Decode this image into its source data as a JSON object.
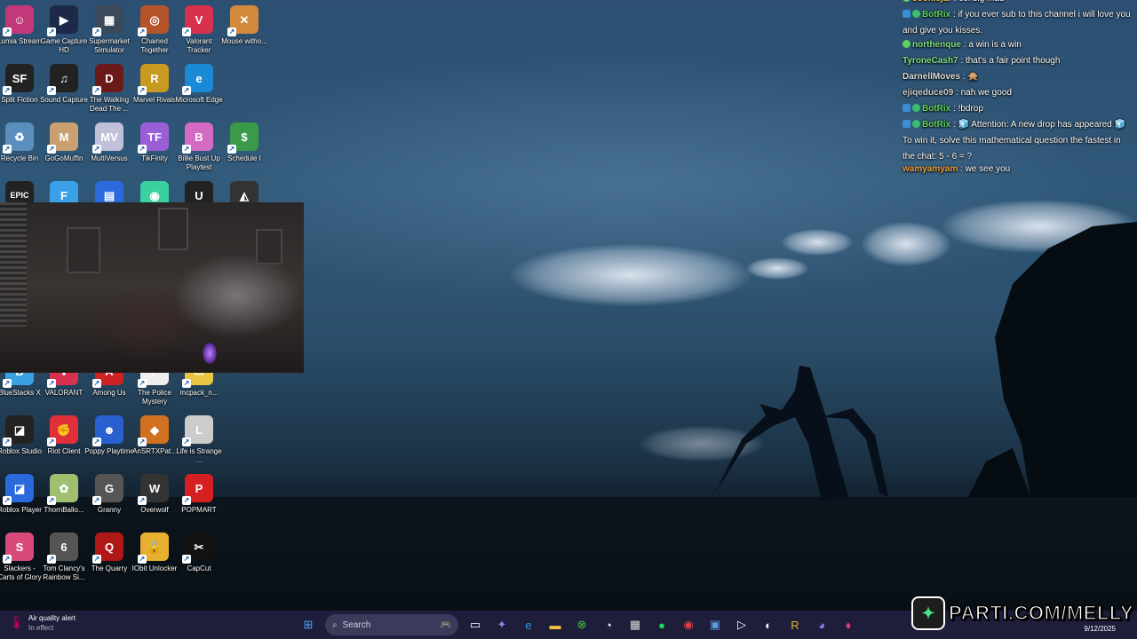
{
  "desktop_icons": [
    {
      "label": "Lumia Stream",
      "glyph": "☺",
      "color": "#c2397a",
      "col": 0,
      "row": 0
    },
    {
      "label": "Game Capture HD",
      "glyph": "▶",
      "color": "#1c2a48",
      "col": 1,
      "row": 0
    },
    {
      "label": "Supermarket Simulator",
      "glyph": "▦",
      "color": "#3b4a5a",
      "col": 2,
      "row": 0
    },
    {
      "label": "Chained Together",
      "glyph": "◎",
      "color": "#b5532a",
      "col": 3,
      "row": 0
    },
    {
      "label": "Valorant Tracker",
      "glyph": "V",
      "color": "#d8314d",
      "col": 4,
      "row": 0
    },
    {
      "label": "Mouse witho...",
      "glyph": "✕",
      "color": "#d28a3c",
      "col": 5,
      "row": 0
    },
    {
      "label": "Split Fiction",
      "glyph": "SF",
      "color": "#222",
      "col": 0,
      "row": 1
    },
    {
      "label": "Sound Capture",
      "glyph": "♫",
      "color": "#222",
      "col": 1,
      "row": 1
    },
    {
      "label": "The Walking Dead The ...",
      "glyph": "D",
      "color": "#6b1a1a",
      "col": 2,
      "row": 1
    },
    {
      "label": "Marvel Rivals",
      "glyph": "R",
      "color": "#c99a22",
      "col": 3,
      "row": 1
    },
    {
      "label": "Microsoft Edge",
      "glyph": "e",
      "color": "#1b8ad6",
      "col": 4,
      "row": 1
    },
    {
      "label": "Recycle Bin",
      "glyph": "♻",
      "color": "#5a8fbd",
      "col": 0,
      "row": 2
    },
    {
      "label": "GoGoMuffin",
      "glyph": "M",
      "color": "#caa070",
      "col": 1,
      "row": 2
    },
    {
      "label": "MultiVersus",
      "glyph": "MV",
      "color": "#c0c0d8",
      "col": 2,
      "row": 2
    },
    {
      "label": "TikFinity",
      "glyph": "TF",
      "color": "#9a5fd6",
      "col": 3,
      "row": 2
    },
    {
      "label": "Billie Bust Up Playtest",
      "glyph": "B",
      "color": "#d46ac4",
      "col": 4,
      "row": 2
    },
    {
      "label": "Schedule I",
      "glyph": "$",
      "color": "#3a9a4a",
      "col": 5,
      "row": 2
    },
    {
      "label": "BlueStacks X",
      "glyph": "B",
      "color": "#3aa0e0",
      "col": 0,
      "row": 6
    },
    {
      "label": "VALORANT",
      "glyph": "V",
      "color": "#d8314d",
      "col": 1,
      "row": 6
    },
    {
      "label": "Among Us",
      "glyph": "A",
      "color": "#c22",
      "col": 2,
      "row": 6
    },
    {
      "label": "The Police Mystery",
      "glyph": "P",
      "color": "#eee",
      "col": 3,
      "row": 6
    },
    {
      "label": "mcpack_n...",
      "glyph": "▭",
      "color": "#e8c440",
      "col": 4,
      "row": 6
    },
    {
      "label": "Roblox Studio",
      "glyph": "◪",
      "color": "#222",
      "col": 0,
      "row": 7
    },
    {
      "label": "Riot Client",
      "glyph": "✊",
      "color": "#e0303a",
      "col": 1,
      "row": 7
    },
    {
      "label": "Poppy Playtime",
      "glyph": "☻",
      "color": "#2a5fd0",
      "col": 2,
      "row": 7
    },
    {
      "label": "AnSRTXPat...",
      "glyph": "◆",
      "color": "#d07020",
      "col": 3,
      "row": 7
    },
    {
      "label": "Life is Strange ...",
      "glyph": "L",
      "color": "#ccc",
      "col": 4,
      "row": 7
    },
    {
      "label": "Roblox Player",
      "glyph": "◪",
      "color": "#2a6adc",
      "col": 0,
      "row": 8
    },
    {
      "label": "ThornBallo...",
      "glyph": "✿",
      "color": "#a0c070",
      "col": 1,
      "row": 8
    },
    {
      "label": "Granny",
      "glyph": "G",
      "color": "#555",
      "col": 2,
      "row": 8
    },
    {
      "label": "Overwolf",
      "glyph": "W",
      "color": "#333",
      "col": 3,
      "row": 8
    },
    {
      "label": "POPMART",
      "glyph": "P",
      "color": "#d42020",
      "col": 4,
      "row": 8
    },
    {
      "label": "Slackers - Carts of Glory",
      "glyph": "S",
      "color": "#d84a7a",
      "col": 0,
      "row": 9
    },
    {
      "label": "Tom Clancy's Rainbow Si...",
      "glyph": "6",
      "color": "#555",
      "col": 1,
      "row": 9
    },
    {
      "label": "The Quarry",
      "glyph": "Q",
      "color": "#b01818",
      "col": 2,
      "row": 9
    },
    {
      "label": "IObit Unlocker",
      "glyph": "🔓",
      "color": "#e8b030",
      "col": 3,
      "row": 9
    },
    {
      "label": "CapCut",
      "glyph": "✂",
      "color": "#111",
      "col": 4,
      "row": 9
    },
    {
      "label": "",
      "glyph": "EPIC",
      "color": "#222",
      "col": 0,
      "row": 3
    },
    {
      "label": "",
      "glyph": "F",
      "color": "#3aa0e8",
      "col": 1,
      "row": 3
    },
    {
      "label": "",
      "glyph": "▤",
      "color": "#2a6adc",
      "col": 2,
      "row": 3
    },
    {
      "label": "",
      "glyph": "◉",
      "color": "#3ad0a0",
      "col": 3,
      "row": 3
    },
    {
      "label": "",
      "glyph": "U",
      "color": "#222",
      "col": 4,
      "row": 3
    },
    {
      "label": "",
      "glyph": "◭",
      "color": "#333",
      "col": 5,
      "row": 3
    }
  ],
  "chat": [
    {
      "name": "cookiejar",
      "name_color": "#f5c542",
      "text": "col big mad",
      "badges": [
        "gem"
      ]
    },
    {
      "name": "BotRix",
      "name_color": "#5fd35f",
      "text": "if you ever sub to this channel i will love you and give you kisses.",
      "badges": [
        "bot",
        "check"
      ]
    },
    {
      "name": "northenque",
      "name_color": "#7ee07e",
      "text": "a win is a win",
      "badges": [
        "gem"
      ]
    },
    {
      "name": "TyroneCash7",
      "name_color": "#7ee07e",
      "text": "that's a fair point though",
      "badges": []
    },
    {
      "name": "DarnellMoves",
      "name_color": "#dddddd",
      "text": "🙊",
      "badges": []
    },
    {
      "name": "ejiqeduce09",
      "name_color": "#cfcfcf",
      "text": "nah we good",
      "badges": []
    },
    {
      "name": "BotRix",
      "name_color": "#5fd35f",
      "text": "!bdrop",
      "badges": [
        "bot",
        "check"
      ]
    },
    {
      "name": "BotRix",
      "name_color": "#5fd35f",
      "text": "🧊 Attention: A new drop has appeared 🧊 To win it, solve this mathematical question the fastest in the chat: 5 - 6 = ?",
      "badges": [
        "bot",
        "check"
      ]
    },
    {
      "name": "wamyamyam",
      "name_color": "#e8a040",
      "text": "we see you",
      "badges": []
    }
  ],
  "taskbar": {
    "alert_title": "Air quality alert",
    "alert_sub": "In effect",
    "search_placeholder": "Search",
    "date": "9/12/2025"
  },
  "brand": {
    "text": "PARTI.COM/MELLY"
  }
}
